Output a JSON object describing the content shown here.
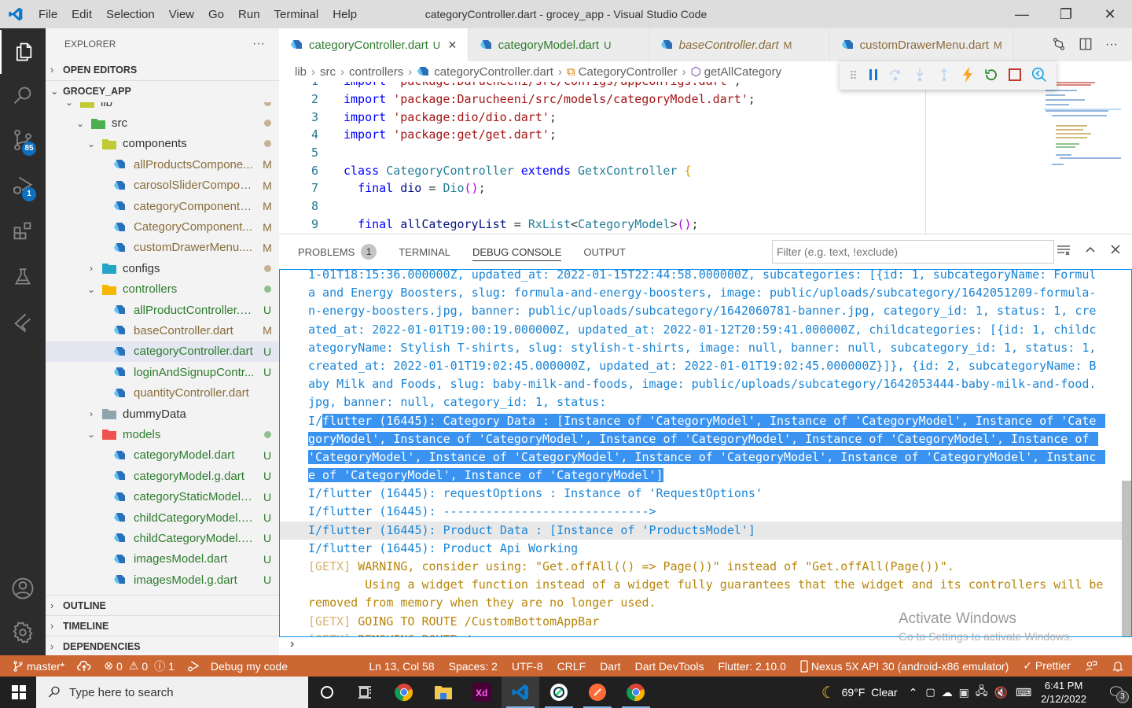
{
  "window": {
    "title": "categoryController.dart - grocey_app - Visual Studio Code",
    "menu": [
      "File",
      "Edit",
      "Selection",
      "View",
      "Go",
      "Run",
      "Terminal",
      "Help"
    ],
    "controls": {
      "minimize": "—",
      "restore": "❐",
      "close": "✕"
    }
  },
  "activity_bar": {
    "items": [
      {
        "name": "explorer",
        "icon": "files-icon"
      },
      {
        "name": "search",
        "icon": "search-icon"
      },
      {
        "name": "source-control",
        "icon": "source-control-icon",
        "badge": "85"
      },
      {
        "name": "run-debug",
        "icon": "debug-icon",
        "badge": "1"
      },
      {
        "name": "extensions",
        "icon": "extensions-icon"
      },
      {
        "name": "testing",
        "icon": "flask-icon"
      },
      {
        "name": "flutter",
        "icon": "flutter-icon"
      }
    ],
    "bottom": [
      {
        "name": "accounts",
        "icon": "account-icon"
      },
      {
        "name": "settings",
        "icon": "gear-icon"
      }
    ]
  },
  "explorer": {
    "header": "EXPLORER",
    "more": "···",
    "open_editors": "OPEN EDITORS",
    "workspace": "GROCEY_APP",
    "tree": [
      {
        "name": "lib",
        "type": "folder",
        "depth": 1,
        "expanded": true,
        "status": "dot",
        "dot": "#c5b396",
        "color": "#333"
      },
      {
        "name": "src",
        "type": "folder",
        "depth": 2,
        "expanded": true,
        "status": "dot",
        "dot": "#c5b396",
        "color": "#333",
        "folder": "#4caf50"
      },
      {
        "name": "components",
        "type": "folder",
        "depth": 3,
        "expanded": true,
        "status": "dot",
        "dot": "#c5b396",
        "color": "#333",
        "folder": "#c0ca33"
      },
      {
        "name": "allProductsCompone...",
        "type": "file",
        "depth": 4,
        "status": "M",
        "color": "#8a6d3b"
      },
      {
        "name": "carosolSliderCompon...",
        "type": "file",
        "depth": 4,
        "status": "M",
        "color": "#8a6d3b"
      },
      {
        "name": "categoryComponentS...",
        "type": "file",
        "depth": 4,
        "status": "M",
        "color": "#8a6d3b"
      },
      {
        "name": "CategoryComponent...",
        "type": "file",
        "depth": 4,
        "status": "M",
        "color": "#8a6d3b"
      },
      {
        "name": "customDrawerMenu....",
        "type": "file",
        "depth": 4,
        "status": "M",
        "color": "#8a6d3b"
      },
      {
        "name": "configs",
        "type": "folder",
        "depth": 3,
        "expanded": false,
        "status": "dot",
        "dot": "#c5b396",
        "color": "#333",
        "folder": "#26a6c6"
      },
      {
        "name": "controllers",
        "type": "folder",
        "depth": 3,
        "expanded": true,
        "status": "dot",
        "dot": "#8fbf8f",
        "color": "#2d7c2d",
        "folder": "#f5b800"
      },
      {
        "name": "allProductController.d...",
        "type": "file",
        "depth": 4,
        "status": "U",
        "color": "#2d7c2d"
      },
      {
        "name": "baseController.dart",
        "type": "file",
        "depth": 4,
        "status": "M",
        "color": "#8a6d3b"
      },
      {
        "name": "categoryController.dart",
        "type": "file",
        "depth": 4,
        "status": "U",
        "color": "#2d7c2d",
        "selected": true
      },
      {
        "name": "loginAndSignupContr...",
        "type": "file",
        "depth": 4,
        "status": "U",
        "color": "#2d7c2d"
      },
      {
        "name": "quantityController.dart",
        "type": "file",
        "depth": 4,
        "status": "",
        "color": "#8a6d3b"
      },
      {
        "name": "dummyData",
        "type": "folder",
        "depth": 3,
        "expanded": false,
        "status": "",
        "color": "#333",
        "folder": "#90a4ae"
      },
      {
        "name": "models",
        "type": "folder",
        "depth": 3,
        "expanded": true,
        "status": "dot",
        "dot": "#8fbf8f",
        "color": "#2d7c2d",
        "folder": "#ef5350"
      },
      {
        "name": "categoryModel.dart",
        "type": "file",
        "depth": 4,
        "status": "U",
        "color": "#2d7c2d"
      },
      {
        "name": "categoryModel.g.dart",
        "type": "file",
        "depth": 4,
        "status": "U",
        "color": "#2d7c2d"
      },
      {
        "name": "categoryStaticModel.d...",
        "type": "file",
        "depth": 4,
        "status": "U",
        "color": "#2d7c2d"
      },
      {
        "name": "childCategoryModel.d...",
        "type": "file",
        "depth": 4,
        "status": "U",
        "color": "#2d7c2d"
      },
      {
        "name": "childCategoryModel.g...",
        "type": "file",
        "depth": 4,
        "status": "U",
        "color": "#2d7c2d"
      },
      {
        "name": "imagesModel.dart",
        "type": "file",
        "depth": 4,
        "status": "U",
        "color": "#2d7c2d"
      },
      {
        "name": "imagesModel.g.dart",
        "type": "file",
        "depth": 4,
        "status": "U",
        "color": "#2d7c2d"
      }
    ],
    "outline": "OUTLINE",
    "timeline": "TIMELINE",
    "dependencies": "DEPENDENCIES"
  },
  "tabs": [
    {
      "label": "categoryController.dart",
      "mark": "U",
      "active": true,
      "italic": false,
      "color": "#2d7c2d",
      "close": "×"
    },
    {
      "label": "categoryModel.dart",
      "mark": "U",
      "active": false,
      "italic": false,
      "color": "#2d7c2d"
    },
    {
      "label": "baseController.dart",
      "mark": "M",
      "active": false,
      "italic": true,
      "color": "#8a6d3b"
    },
    {
      "label": "customDrawerMenu.dart",
      "mark": "M",
      "active": false,
      "italic": false,
      "color": "#8a6d3b"
    }
  ],
  "breadcrumb": [
    "lib",
    "src",
    "controllers",
    "categoryController.dart",
    "CategoryController",
    "getAllCategory"
  ],
  "code_lines": [
    {
      "n": "1",
      "html": "<span class='kw'>import</span> <span class='str'>'package:Darucheeni/src/configs/appConfigs.dart'</span>;"
    },
    {
      "n": "2",
      "html": "<span class='kw'>import</span> <span class='str'>'package:Darucheeni/src/models/categoryModel.dart'</span>;"
    },
    {
      "n": "3",
      "html": "<span class='kw'>import</span> <span class='str'>'package:dio/dio.dart'</span>;"
    },
    {
      "n": "4",
      "html": "<span class='kw'>import</span> <span class='str'>'package:get/get.dart'</span>;"
    },
    {
      "n": "5",
      "html": ""
    },
    {
      "n": "6",
      "html": "<span class='kw'>class</span> <span class='cls'>CategoryController</span> <span class='kw'>extends</span> <span class='cls'>GetxController</span> <span class='br'>{</span>"
    },
    {
      "n": "7",
      "html": "  <span class='kw'>final</span> <span class='var'>dio</span> = <span class='cls'>Dio</span><span class='br2'>()</span>;"
    },
    {
      "n": "8",
      "html": ""
    },
    {
      "n": "9",
      "html": "  <span class='kw'>final</span> <span class='var'>allCategoryList</span> = <span class='cls'>RxList</span>&lt;<span class='cls'>CategoryModel</span>&gt;<span class='br2'>()</span>;"
    }
  ],
  "debug_toolbar": [
    "drag-handle-icon",
    "pause-icon",
    "step-over-icon",
    "step-into-icon",
    "step-out-icon",
    "hot-reload-icon",
    "hot-restart-icon",
    "stop-icon",
    "devtools-icon"
  ],
  "panel": {
    "tabs": [
      {
        "label": "PROBLEMS",
        "count": "1"
      },
      {
        "label": "TERMINAL"
      },
      {
        "label": "DEBUG CONSOLE",
        "active": true
      },
      {
        "label": "OUTPUT"
      }
    ],
    "filter_placeholder": "Filter (e.g. text, !exclude)",
    "lines": [
      {
        "text": "1-01T18:15:36.000000Z, updated_at: 2022-01-15T22:44:58.000000Z, subcategories: [{id: 1, subcategoryName: Formul",
        "kind": "info"
      },
      {
        "text": "a and Energy Boosters, slug: formula-and-energy-boosters, image: public/uploads/subcategory/1642051209-formula-",
        "kind": "info"
      },
      {
        "text": "n-energy-boosters.jpg, banner: public/uploads/subcategory/1642060781-banner.jpg, category_id: 1, status: 1, cre",
        "kind": "info"
      },
      {
        "text": "ated_at: 2022-01-01T19:00:19.000000Z, updated_at: 2022-01-12T20:59:41.000000Z, childcategories: [{id: 1, childc",
        "kind": "info"
      },
      {
        "text": "ategoryName: Stylish T-shirts, slug: stylish-t-shirts, image: null, banner: null, subcategory_id: 1, status: 1,",
        "kind": "info"
      },
      {
        "text": "created_at: 2022-01-01T19:02:45.000000Z, updated_at: 2022-01-01T19:02:45.000000Z}]}, {id: 2, subcategoryName: B",
        "kind": "info"
      },
      {
        "text": "aby Milk and Foods, slug: baby-milk-and-foods, image: public/uploads/subcategory/1642053444-baby-milk-and-food.",
        "kind": "info"
      },
      {
        "text": "jpg, banner: null, category_id: 1, status:",
        "kind": "info"
      },
      {
        "prefix": "I/",
        "text": "flutter (16445): Category Data : [Instance of 'CategoryModel', Instance of 'CategoryModel', Instance of 'Cate",
        "kind": "selected"
      },
      {
        "text": "goryModel', Instance of 'CategoryModel', Instance of 'CategoryModel', Instance of 'CategoryModel', Instance of",
        "kind": "selected"
      },
      {
        "text": "'CategoryModel', Instance of 'CategoryModel', Instance of 'CategoryModel', Instance of 'CategoryModel', Instanc",
        "kind": "selected"
      },
      {
        "text": "e of 'CategoryModel', Instance of 'CategoryModel']",
        "kind": "selected"
      },
      {
        "text": "I/flutter (16445): requestOptions : Instance of 'RequestOptions'",
        "kind": "info"
      },
      {
        "text": "I/flutter (16445): ----------------------------->",
        "kind": "info"
      },
      {
        "text": "I/flutter (16445): Product Data : [Instance of 'ProductsModel']",
        "kind": "hover"
      },
      {
        "text": "I/flutter (16445): Product Api Working",
        "kind": "info"
      },
      {
        "prefix": "[GETX]",
        "text": " WARNING, consider using: \"Get.offAll(() => Page())\" instead of \"Get.offAll(Page())\".",
        "kind": "warn"
      },
      {
        "text": "        Using a widget function instead of a widget fully guarantees that the widget and its controllers will be",
        "kind": "warn"
      },
      {
        "text": "removed from memory when they are no longer used.",
        "kind": "warn"
      },
      {
        "prefix": "[GETX]",
        "text": " GOING TO ROUTE /CustomBottomAppBar",
        "kind": "warn"
      },
      {
        "prefix": "[GETX]",
        "text": " REMOVING ROUTE /",
        "kind": "warn"
      }
    ],
    "prompt": "›",
    "watermark_title": "Activate Windows",
    "watermark_sub": "Go to Settings to activate Windows."
  },
  "statusbar": {
    "branch": "master*",
    "errors": "0",
    "warnings": "0",
    "infos": "1",
    "debug": "Debug my code",
    "position": "Ln 13, Col 58",
    "spaces": "Spaces: 2",
    "encoding": "UTF-8",
    "eol": "CRLF",
    "language": "Dart",
    "devtools": "Dart DevTools",
    "flutter": "Flutter: 2.10.0",
    "device": "Nexus 5X API 30 (android-x86 emulator)",
    "prettier": "✓ Prettier",
    "color": "#cc6633"
  },
  "taskbar": {
    "search_placeholder": "Type here to search",
    "weather": "69°F  Clear",
    "time": "6:41 PM",
    "date": "2/12/2022",
    "notifications": "3",
    "apps": [
      "cortana",
      "task-view",
      "chrome",
      "file-explorer",
      "adobe-xd",
      "vscode",
      "android-studio",
      "postman",
      "chrome"
    ]
  }
}
